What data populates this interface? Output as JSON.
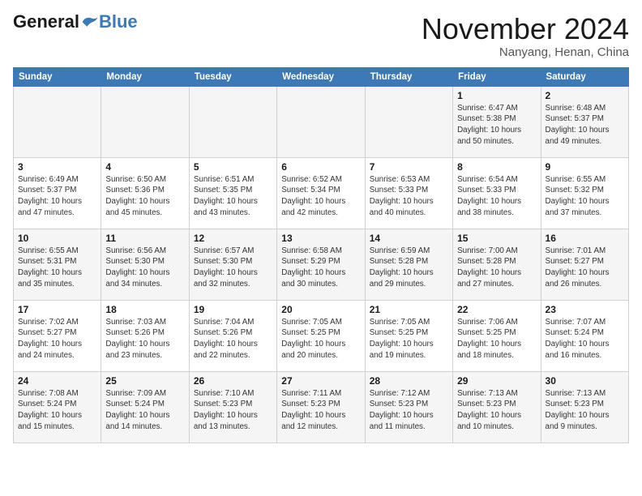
{
  "header": {
    "logo_general": "General",
    "logo_blue": "Blue",
    "month_title": "November 2024",
    "subtitle": "Nanyang, Henan, China"
  },
  "days_of_week": [
    "Sunday",
    "Monday",
    "Tuesday",
    "Wednesday",
    "Thursday",
    "Friday",
    "Saturday"
  ],
  "weeks": [
    [
      {
        "day": "",
        "info": ""
      },
      {
        "day": "",
        "info": ""
      },
      {
        "day": "",
        "info": ""
      },
      {
        "day": "",
        "info": ""
      },
      {
        "day": "",
        "info": ""
      },
      {
        "day": "1",
        "info": "Sunrise: 6:47 AM\nSunset: 5:38 PM\nDaylight: 10 hours and 50 minutes."
      },
      {
        "day": "2",
        "info": "Sunrise: 6:48 AM\nSunset: 5:37 PM\nDaylight: 10 hours and 49 minutes."
      }
    ],
    [
      {
        "day": "3",
        "info": "Sunrise: 6:49 AM\nSunset: 5:37 PM\nDaylight: 10 hours and 47 minutes."
      },
      {
        "day": "4",
        "info": "Sunrise: 6:50 AM\nSunset: 5:36 PM\nDaylight: 10 hours and 45 minutes."
      },
      {
        "day": "5",
        "info": "Sunrise: 6:51 AM\nSunset: 5:35 PM\nDaylight: 10 hours and 43 minutes."
      },
      {
        "day": "6",
        "info": "Sunrise: 6:52 AM\nSunset: 5:34 PM\nDaylight: 10 hours and 42 minutes."
      },
      {
        "day": "7",
        "info": "Sunrise: 6:53 AM\nSunset: 5:33 PM\nDaylight: 10 hours and 40 minutes."
      },
      {
        "day": "8",
        "info": "Sunrise: 6:54 AM\nSunset: 5:33 PM\nDaylight: 10 hours and 38 minutes."
      },
      {
        "day": "9",
        "info": "Sunrise: 6:55 AM\nSunset: 5:32 PM\nDaylight: 10 hours and 37 minutes."
      }
    ],
    [
      {
        "day": "10",
        "info": "Sunrise: 6:55 AM\nSunset: 5:31 PM\nDaylight: 10 hours and 35 minutes."
      },
      {
        "day": "11",
        "info": "Sunrise: 6:56 AM\nSunset: 5:30 PM\nDaylight: 10 hours and 34 minutes."
      },
      {
        "day": "12",
        "info": "Sunrise: 6:57 AM\nSunset: 5:30 PM\nDaylight: 10 hours and 32 minutes."
      },
      {
        "day": "13",
        "info": "Sunrise: 6:58 AM\nSunset: 5:29 PM\nDaylight: 10 hours and 30 minutes."
      },
      {
        "day": "14",
        "info": "Sunrise: 6:59 AM\nSunset: 5:28 PM\nDaylight: 10 hours and 29 minutes."
      },
      {
        "day": "15",
        "info": "Sunrise: 7:00 AM\nSunset: 5:28 PM\nDaylight: 10 hours and 27 minutes."
      },
      {
        "day": "16",
        "info": "Sunrise: 7:01 AM\nSunset: 5:27 PM\nDaylight: 10 hours and 26 minutes."
      }
    ],
    [
      {
        "day": "17",
        "info": "Sunrise: 7:02 AM\nSunset: 5:27 PM\nDaylight: 10 hours and 24 minutes."
      },
      {
        "day": "18",
        "info": "Sunrise: 7:03 AM\nSunset: 5:26 PM\nDaylight: 10 hours and 23 minutes."
      },
      {
        "day": "19",
        "info": "Sunrise: 7:04 AM\nSunset: 5:26 PM\nDaylight: 10 hours and 22 minutes."
      },
      {
        "day": "20",
        "info": "Sunrise: 7:05 AM\nSunset: 5:25 PM\nDaylight: 10 hours and 20 minutes."
      },
      {
        "day": "21",
        "info": "Sunrise: 7:05 AM\nSunset: 5:25 PM\nDaylight: 10 hours and 19 minutes."
      },
      {
        "day": "22",
        "info": "Sunrise: 7:06 AM\nSunset: 5:25 PM\nDaylight: 10 hours and 18 minutes."
      },
      {
        "day": "23",
        "info": "Sunrise: 7:07 AM\nSunset: 5:24 PM\nDaylight: 10 hours and 16 minutes."
      }
    ],
    [
      {
        "day": "24",
        "info": "Sunrise: 7:08 AM\nSunset: 5:24 PM\nDaylight: 10 hours and 15 minutes."
      },
      {
        "day": "25",
        "info": "Sunrise: 7:09 AM\nSunset: 5:24 PM\nDaylight: 10 hours and 14 minutes."
      },
      {
        "day": "26",
        "info": "Sunrise: 7:10 AM\nSunset: 5:23 PM\nDaylight: 10 hours and 13 minutes."
      },
      {
        "day": "27",
        "info": "Sunrise: 7:11 AM\nSunset: 5:23 PM\nDaylight: 10 hours and 12 minutes."
      },
      {
        "day": "28",
        "info": "Sunrise: 7:12 AM\nSunset: 5:23 PM\nDaylight: 10 hours and 11 minutes."
      },
      {
        "day": "29",
        "info": "Sunrise: 7:13 AM\nSunset: 5:23 PM\nDaylight: 10 hours and 10 minutes."
      },
      {
        "day": "30",
        "info": "Sunrise: 7:13 AM\nSunset: 5:23 PM\nDaylight: 10 hours and 9 minutes."
      }
    ]
  ]
}
